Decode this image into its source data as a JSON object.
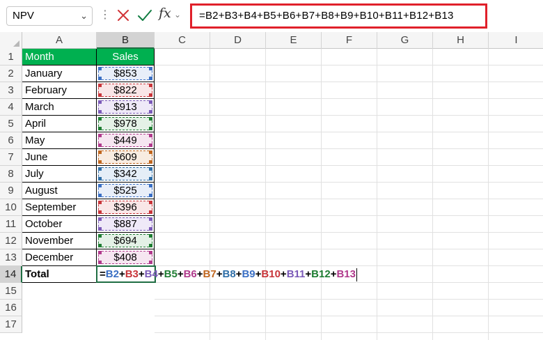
{
  "formula_bar": {
    "name_box": "NPV",
    "fx_label": "fx",
    "formula": "=B2+B3+B4+B5+B6+B7+B8+B9+B10+B11+B12+B13"
  },
  "columns": [
    "A",
    "B",
    "C",
    "D",
    "E",
    "F",
    "G",
    "H",
    "I"
  ],
  "selected_column": "B",
  "row_numbers": [
    "1",
    "2",
    "3",
    "4",
    "5",
    "6",
    "7",
    "8",
    "9",
    "10",
    "11",
    "12",
    "13",
    "14",
    "15",
    "16",
    "17"
  ],
  "selected_row": "14",
  "header": {
    "month": "Month",
    "sales": "Sales"
  },
  "rows": [
    {
      "month": "January",
      "sales": "$853"
    },
    {
      "month": "February",
      "sales": "$822"
    },
    {
      "month": "March",
      "sales": "$913"
    },
    {
      "month": "April",
      "sales": "$978"
    },
    {
      "month": "May",
      "sales": "$449"
    },
    {
      "month": "June",
      "sales": "$609"
    },
    {
      "month": "July",
      "sales": "$342"
    },
    {
      "month": "August",
      "sales": "$525"
    },
    {
      "month": "September",
      "sales": "$396"
    },
    {
      "month": "October",
      "sales": "$887"
    },
    {
      "month": "November",
      "sales": "$694"
    },
    {
      "month": "December",
      "sales": "$408"
    }
  ],
  "total_label": "Total",
  "edit_tokens": [
    {
      "text": "=",
      "color": "#000000"
    },
    {
      "text": "B2",
      "color": "#3a6fc4"
    },
    {
      "text": "+",
      "color": "#000000"
    },
    {
      "text": "B3",
      "color": "#c8353a"
    },
    {
      "text": "+",
      "color": "#000000"
    },
    {
      "text": "B4",
      "color": "#7b5ab8"
    },
    {
      "text": "+",
      "color": "#000000"
    },
    {
      "text": "B5",
      "color": "#1e7d32"
    },
    {
      "text": "+",
      "color": "#000000"
    },
    {
      "text": "B6",
      "color": "#b03a8c"
    },
    {
      "text": "+",
      "color": "#000000"
    },
    {
      "text": "B7",
      "color": "#c0661e"
    },
    {
      "text": "+",
      "color": "#000000"
    },
    {
      "text": "B8",
      "color": "#2f6fa8"
    },
    {
      "text": "+",
      "color": "#000000"
    },
    {
      "text": "B9",
      "color": "#3a6fc4"
    },
    {
      "text": "+",
      "color": "#000000"
    },
    {
      "text": "B10",
      "color": "#c8353a"
    },
    {
      "text": "+",
      "color": "#000000"
    },
    {
      "text": "B11",
      "color": "#7b5ab8"
    },
    {
      "text": "+",
      "color": "#000000"
    },
    {
      "text": "B12",
      "color": "#1e7d32"
    },
    {
      "text": "+",
      "color": "#000000"
    },
    {
      "text": "B13",
      "color": "#b03a8c"
    }
  ],
  "ref_colors": [
    {
      "border": "#3a6fc4",
      "fill": "#e8eef9"
    },
    {
      "border": "#c8353a",
      "fill": "#f9e6e7"
    },
    {
      "border": "#7b5ab8",
      "fill": "#efe9f8"
    },
    {
      "border": "#1e7d32",
      "fill": "#e4f1e6"
    },
    {
      "border": "#b03a8c",
      "fill": "#f6e6f1"
    },
    {
      "border": "#c0661e",
      "fill": "#f8ece1"
    },
    {
      "border": "#2f6fa8",
      "fill": "#e5eef7"
    },
    {
      "border": "#3a6fc4",
      "fill": "#e8eef9"
    },
    {
      "border": "#c8353a",
      "fill": "#f9e6e7"
    },
    {
      "border": "#7b5ab8",
      "fill": "#efe9f8"
    },
    {
      "border": "#1e7d32",
      "fill": "#e4f1e6"
    },
    {
      "border": "#b03a8c",
      "fill": "#f6e6f1"
    }
  ],
  "colors": {
    "header_fill": "#00b050",
    "formula_box_border": "#e0202a",
    "selection": "#1f6e43"
  },
  "icons": {
    "cancel": "close-icon",
    "enter": "check-icon",
    "function": "fx-icon",
    "dropdown": "chevron-down-icon"
  }
}
